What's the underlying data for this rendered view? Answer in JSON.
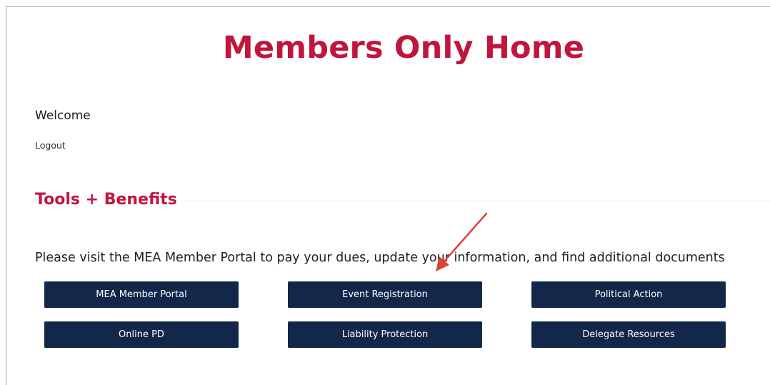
{
  "page": {
    "title": "Members Only Home",
    "welcome": "Welcome",
    "logout": "Logout"
  },
  "section": {
    "heading": "Tools + Benefits",
    "intro": "Please visit the MEA Member Portal to pay your dues, update your information, and find additional documents"
  },
  "buttons": [
    {
      "label": "MEA Member Portal"
    },
    {
      "label": "Event Registration"
    },
    {
      "label": "Political Action"
    },
    {
      "label": "Online PD"
    },
    {
      "label": "Liability Protection"
    },
    {
      "label": "Delegate Resources"
    }
  ],
  "colors": {
    "title": "#c0163e",
    "button_bg": "#12274a",
    "button_text": "#ffffff",
    "annotation_arrow": "#e0403a"
  }
}
